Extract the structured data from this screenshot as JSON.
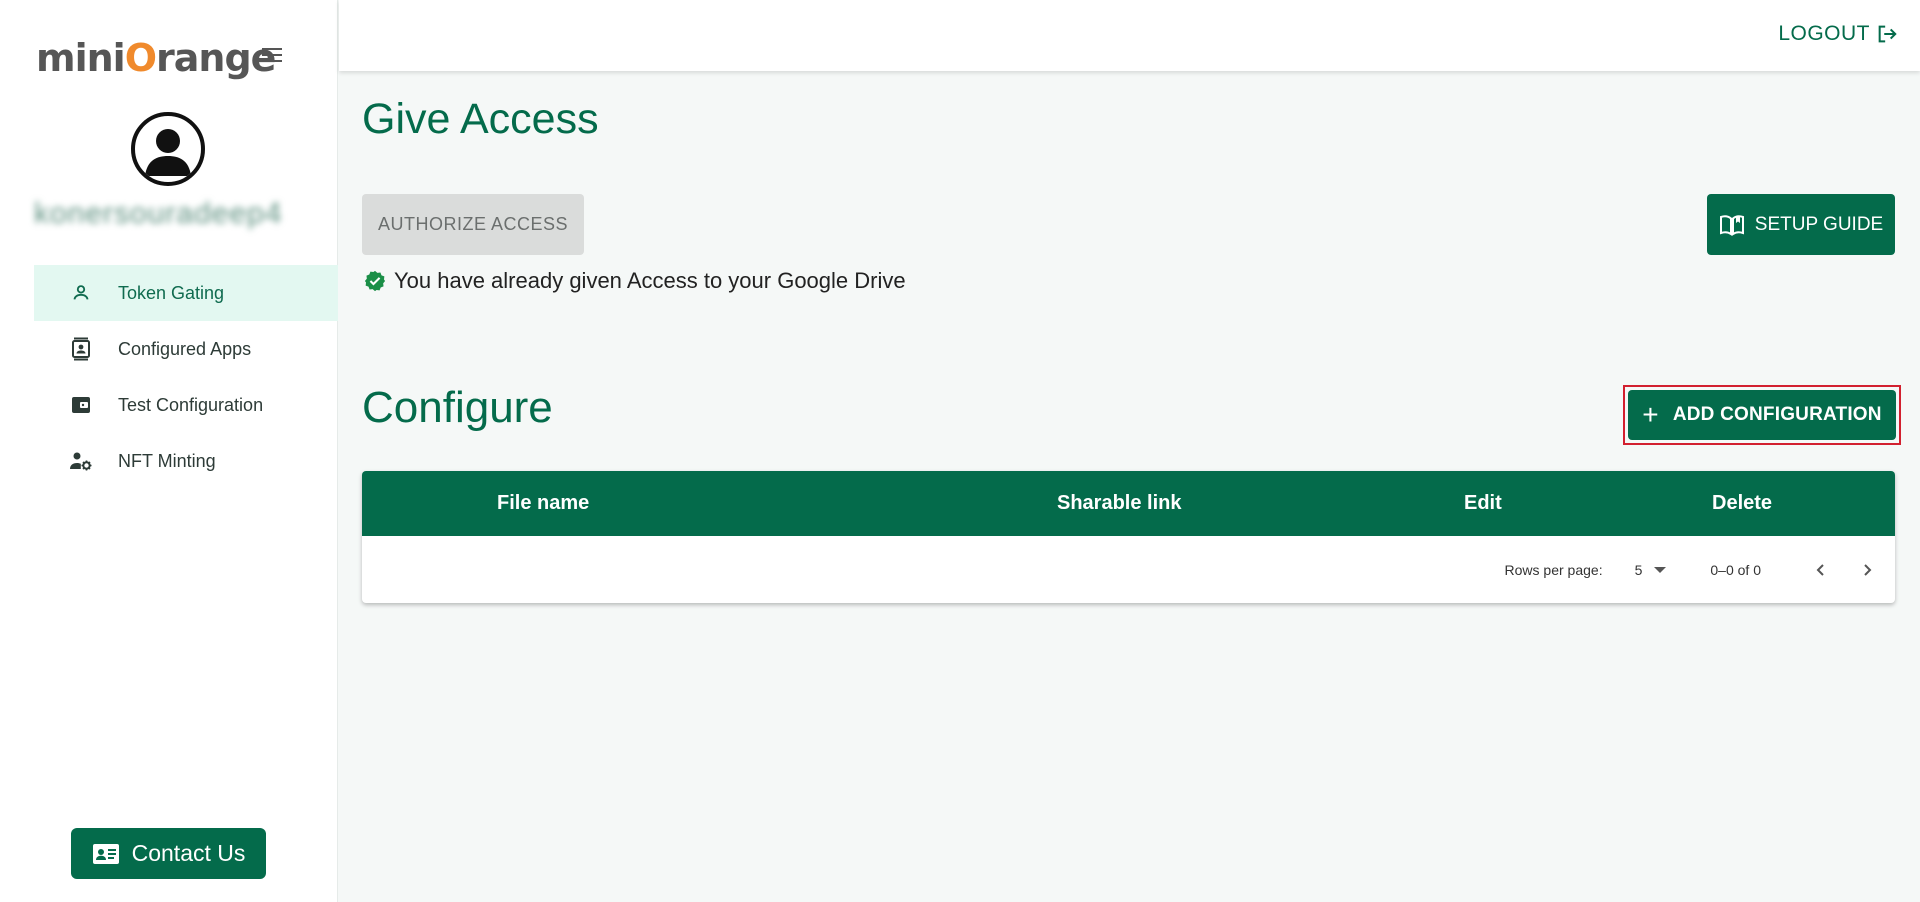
{
  "brand": {
    "logo_prefix": "mini",
    "logo_o": "O",
    "logo_suffix": "range"
  },
  "sidebar": {
    "username": "konersouradeep4",
    "items": [
      {
        "label": "Token Gating",
        "icon": "person-icon",
        "active": true
      },
      {
        "label": "Configured Apps",
        "icon": "contact-card-icon",
        "active": false
      },
      {
        "label": "Test Configuration",
        "icon": "wallet-icon",
        "active": false
      },
      {
        "label": "NFT Minting",
        "icon": "user-gear-icon",
        "active": false
      }
    ],
    "contact_label": "Contact Us"
  },
  "topbar": {
    "logout_label": "LOGOUT"
  },
  "give_access": {
    "title": "Give Access",
    "authorize_label": "AUTHORIZE ACCESS",
    "setup_guide_label": "SETUP GUIDE",
    "status_message": "You have already given Access to your Google Drive"
  },
  "configure": {
    "title": "Configure",
    "add_label": "ADD CONFIGURATION",
    "table": {
      "columns": [
        "File name",
        "Sharable link",
        "Edit",
        "Delete"
      ],
      "rows": [],
      "rows_per_page_label": "Rows per page:",
      "rows_per_page_value": "5",
      "range_text": "0–0 of 0"
    }
  },
  "colors": {
    "brand_green": "#046b4b",
    "active_bg": "#e3f8f1",
    "highlight_border": "#d2202f",
    "logo_orange": "#f08a2c"
  }
}
